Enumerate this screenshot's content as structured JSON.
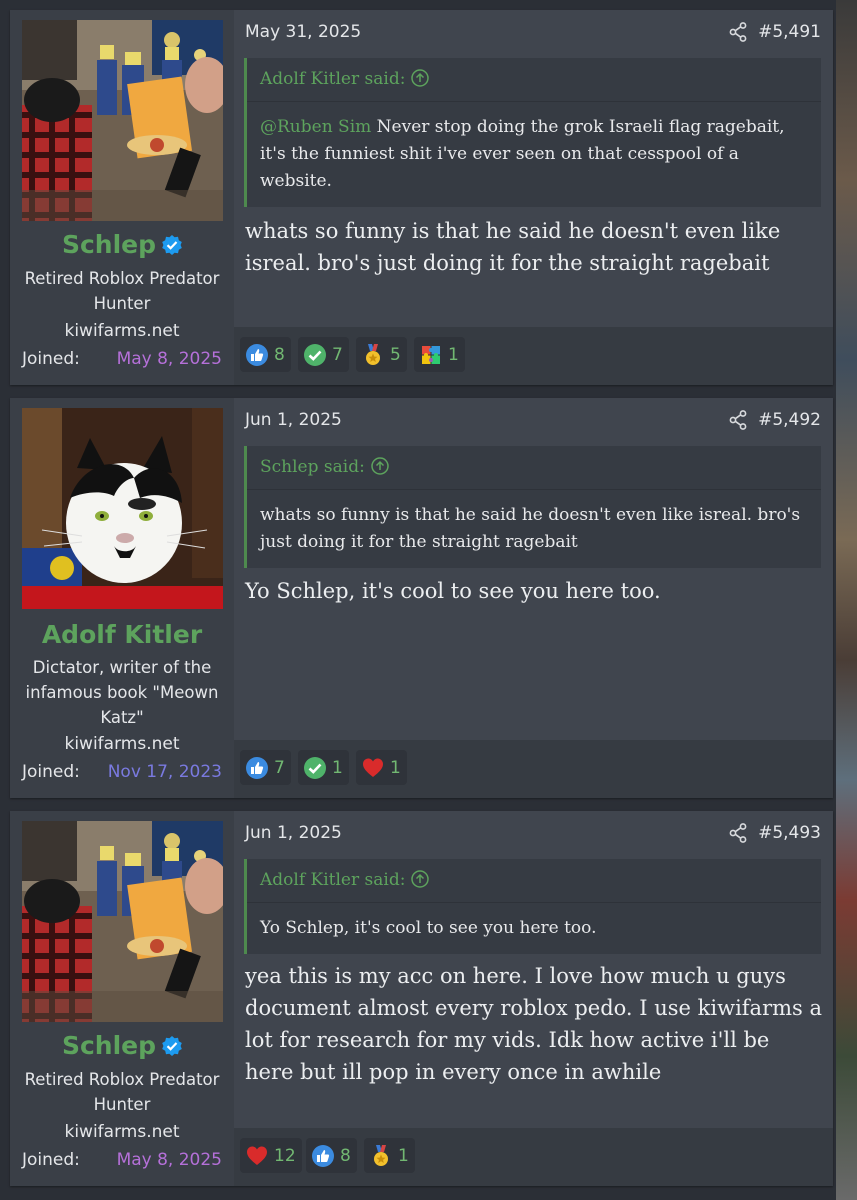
{
  "posts": [
    {
      "author": {
        "name": "Schlep",
        "verified": true,
        "title": "Retired Roblox Predator Hunter",
        "site": "kiwifarms.net",
        "joined_label": "Joined:",
        "joined_date": "May 8, 2025",
        "joined_color": "#b570d9"
      },
      "date": "May 31, 2025",
      "number": "#5,491",
      "quote": {
        "header": "Adolf Kitler said:",
        "mention": "@Ruben Sim",
        "text": " Never stop doing the grok Israeli flag ragebait, it's the funniest shit i've ever seen on that cesspool of a website."
      },
      "body": "whats so funny is that he said he doesn't even like isreal. bro's just doing it for the straight ragebait",
      "reactions": [
        {
          "icon": "like-icon",
          "count": "8"
        },
        {
          "icon": "check-icon",
          "count": "7"
        },
        {
          "icon": "medal-icon",
          "count": "5"
        },
        {
          "icon": "autism-puzzle-icon",
          "count": "1"
        }
      ]
    },
    {
      "author": {
        "name": "Adolf Kitler",
        "verified": false,
        "title": "Dictator, writer of the infamous book \"Meown Katz\"",
        "site": "kiwifarms.net",
        "joined_label": "Joined:",
        "joined_date": "Nov 17, 2023",
        "joined_color": "#7a7ae0"
      },
      "date": "Jun 1, 2025",
      "number": "#5,492",
      "quote": {
        "header": "Schlep said:",
        "mention": "",
        "text": "whats so funny is that he said he doesn't even like isreal. bro's just doing it for the straight ragebait"
      },
      "body": "Yo Schlep, it's cool to see you here too.",
      "reactions": [
        {
          "icon": "like-icon",
          "count": "7"
        },
        {
          "icon": "check-icon",
          "count": "1"
        },
        {
          "icon": "heart-icon",
          "count": "1"
        }
      ]
    },
    {
      "author": {
        "name": "Schlep",
        "verified": true,
        "title": "Retired Roblox Predator Hunter",
        "site": "kiwifarms.net",
        "joined_label": "Joined:",
        "joined_date": "May 8, 2025",
        "joined_color": "#b570d9"
      },
      "date": "Jun 1, 2025",
      "number": "#5,493",
      "quote": {
        "header": "Adolf Kitler said:",
        "mention": "",
        "text": "Yo Schlep, it's cool to see you here too."
      },
      "body": "yea this is my acc on here. I love how much u guys document almost every roblox pedo. I use kiwifarms a lot for research for my vids. Idk how active i'll be here but ill pop in every once in awhile",
      "reactions": [
        {
          "icon": "heart-icon",
          "count": "12"
        },
        {
          "icon": "like-icon",
          "count": "8"
        },
        {
          "icon": "medal-icon",
          "count": "1"
        }
      ]
    }
  ],
  "colors": {
    "username": "#5da35d",
    "quote_border": "#4e8a4e",
    "reaction_count": "#72b872"
  }
}
